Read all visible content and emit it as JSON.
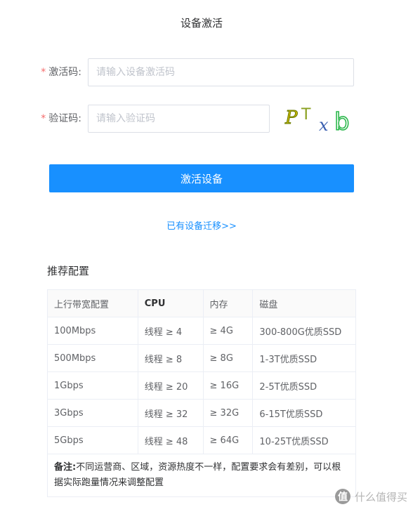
{
  "page_title": "设备激活",
  "form": {
    "activation_code": {
      "required_mark": "*",
      "label": "激活码:",
      "placeholder": "请输入设备激活码",
      "value": ""
    },
    "verify_code": {
      "required_mark": "*",
      "label": "验证码:",
      "placeholder": "请输入验证码",
      "value": ""
    },
    "captcha": {
      "chars": [
        "P",
        "T",
        "x",
        "b"
      ],
      "colors": [
        "#c8b400",
        "#8aa020",
        "#3a5fb0",
        "#2db84d"
      ]
    },
    "submit_label": "激活设备",
    "migrate_link": "已有设备迁移>>"
  },
  "recommend": {
    "title": "推荐配置",
    "headers": [
      "上行带宽配置",
      "CPU",
      "内存",
      "磁盘"
    ],
    "rows": [
      [
        "100Mbps",
        "线程 ≥ 4",
        "≥ 4G",
        "300-800G优质SSD"
      ],
      [
        "500Mbps",
        "线程 ≥ 8",
        "≥ 8G",
        "1-3T优质SSD"
      ],
      [
        "1Gbps",
        "线程 ≥ 20",
        "≥ 16G",
        "2-5T优质SSD"
      ],
      [
        "3Gbps",
        "线程 ≥ 32",
        "≥ 32G",
        "6-15T优质SSD"
      ],
      [
        "5Gbps",
        "线程 ≥ 48",
        "≥ 64G",
        "10-25T优质SSD"
      ]
    ],
    "note_label": "备注:",
    "note_text": "不同运营商、区域，资源热度不一样，配置要求会有差别，可以根据实际跑量情况来调整配置"
  },
  "watermark": {
    "icon_text": "值",
    "text": "什么值得买"
  },
  "colors": {
    "primary": "#1890ff",
    "required": "#f56c6c",
    "border": "#dcdfe6"
  }
}
